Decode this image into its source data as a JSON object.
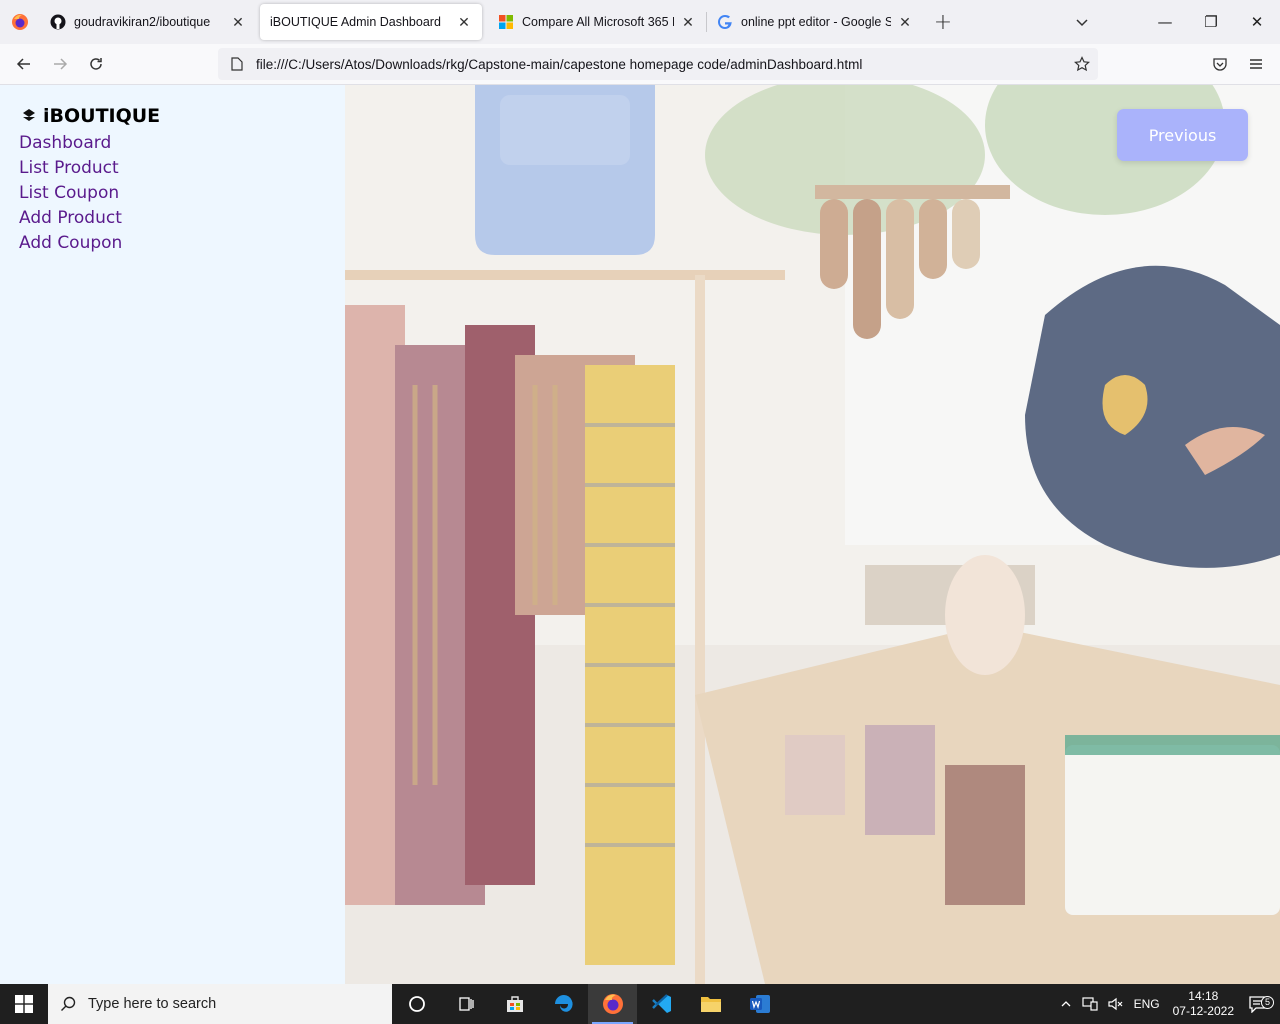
{
  "browser": {
    "tabs": [
      {
        "title": "goudravikiran2/iboutique",
        "favicon": "github-icon"
      },
      {
        "title": "iBOUTIQUE Admin Dashboard",
        "favicon": "none",
        "active": true
      },
      {
        "title": "Compare All Microsoft 365 Plan",
        "favicon": "microsoft-icon"
      },
      {
        "title": "online ppt editor - Google Searc",
        "favicon": "google-icon"
      }
    ],
    "url": "file:///C:/Users/Atos/Downloads/rkg/Capstone-main/capestone homepage code/adminDashboard.html"
  },
  "sidebar": {
    "brand": "iBOUTIQUE",
    "links": [
      "Dashboard",
      "List Product",
      "List Coupon",
      "Add Product",
      "Add Coupon"
    ]
  },
  "hero": {
    "previous_label": "Previous"
  },
  "taskbar": {
    "search_placeholder": "Type here to search",
    "language": "ENG",
    "time": "14:18",
    "date": "07-12-2022",
    "notification_count": "5"
  },
  "colors": {
    "sidebar_bg": "#eef7ff",
    "link": "#5a1a8c",
    "button": "#aab3fb"
  }
}
